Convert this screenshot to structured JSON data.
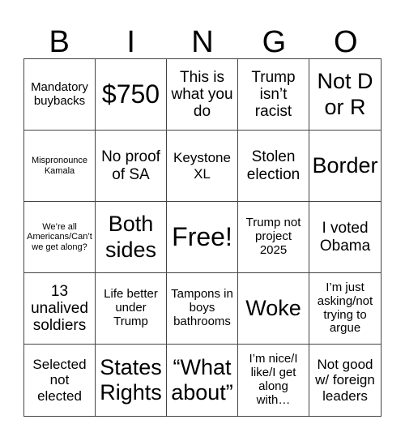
{
  "header": {
    "letters": [
      "B",
      "I",
      "N",
      "G",
      "O"
    ]
  },
  "cells": [
    {
      "text": "Mandatory buybacks"
    },
    {
      "text": "$750"
    },
    {
      "text": "This is what you do"
    },
    {
      "text": "Trump isn’t racist"
    },
    {
      "text": "Not D or R"
    },
    {
      "text": "Mispronounce Kamala"
    },
    {
      "text": "No proof of SA"
    },
    {
      "text": "Keystone XL"
    },
    {
      "text": "Stolen election"
    },
    {
      "text": "Border"
    },
    {
      "text": "We’re all Americans/Can’t we get along?"
    },
    {
      "text": "Both sides"
    },
    {
      "text": "Free!"
    },
    {
      "text": "Trump not project 2025"
    },
    {
      "text": "I voted Obama"
    },
    {
      "text": "13 unalived soldiers"
    },
    {
      "text": "Life better under Trump"
    },
    {
      "text": "Tampons in boys bathrooms"
    },
    {
      "text": "Woke"
    },
    {
      "text": "I’m just asking/not trying to argue"
    },
    {
      "text": "Selected not elected"
    },
    {
      "text": "States Rights"
    },
    {
      "text": "“What about”"
    },
    {
      "text": "I’m nice/I like/I get along with…"
    },
    {
      "text": "Not good w/ foreign leaders"
    }
  ]
}
